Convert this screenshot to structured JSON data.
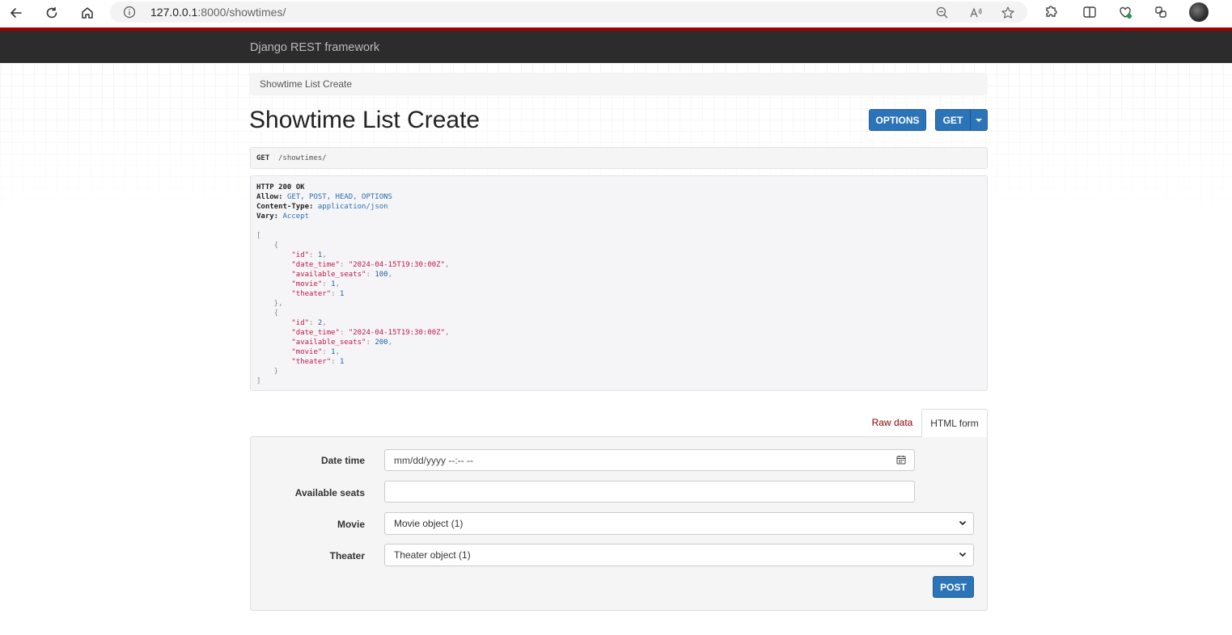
{
  "browser": {
    "url_host": "127.0.0.1",
    "url_rest": ":8000/showtimes/"
  },
  "navbar": {
    "brand": "Django REST framework"
  },
  "breadcrumb": {
    "current": "Showtime List Create"
  },
  "page": {
    "title": "Showtime List Create"
  },
  "toolbar": {
    "options_label": "OPTIONS",
    "get_label": "GET"
  },
  "request": {
    "method": "GET",
    "path": "/showtimes/"
  },
  "response": {
    "status": "HTTP 200 OK",
    "headers": [
      {
        "key": "Allow:",
        "value": "GET, POST, HEAD, OPTIONS"
      },
      {
        "key": "Content-Type:",
        "value": "application/json"
      },
      {
        "key": "Vary:",
        "value": "Accept"
      }
    ],
    "body": [
      {
        "id": 1,
        "date_time": "2024-04-15T19:30:00Z",
        "available_seats": 100,
        "movie": 1,
        "theater": 1
      },
      {
        "id": 2,
        "date_time": "2024-04-15T19:30:00Z",
        "available_seats": 200,
        "movie": 1,
        "theater": 1
      }
    ]
  },
  "tabs": {
    "raw_data": "Raw data",
    "html_form": "HTML form"
  },
  "form": {
    "date_time_label": "Date time",
    "date_time_placeholder": "mm/dd/yyyy  --:-- --",
    "available_seats_label": "Available seats",
    "available_seats_value": "",
    "movie_label": "Movie",
    "movie_selected": "Movie object (1)",
    "theater_label": "Theater",
    "theater_selected": "Theater object (1)",
    "post_label": "POST"
  },
  "colors": {
    "accent": "#2c74b8",
    "navbar": "#2c2c2c",
    "navbar_border": "#a30000",
    "tab_link": "#8b0000"
  }
}
